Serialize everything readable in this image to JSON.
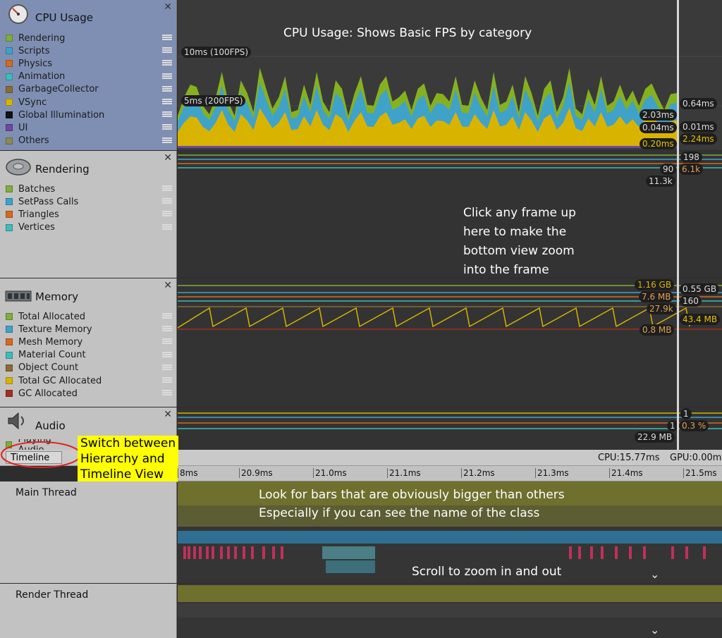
{
  "cpu": {
    "title": "CPU Usage",
    "close": "✕",
    "legend": [
      {
        "label": "Rendering",
        "color": "#7fae3a"
      },
      {
        "label": "Scripts",
        "color": "#3fa2c9"
      },
      {
        "label": "Physics",
        "color": "#d46a1f"
      },
      {
        "label": "Animation",
        "color": "#3fbbbb"
      },
      {
        "label": "GarbageCollector",
        "color": "#8a6b36"
      },
      {
        "label": "VSync",
        "color": "#d8b400"
      },
      {
        "label": "Global Illumination",
        "color": "#111111"
      },
      {
        "label": "UI",
        "color": "#6f48a0"
      },
      {
        "label": "Others",
        "color": "#8a8a55"
      }
    ],
    "grid_10ms": "10ms (100FPS)",
    "grid_5ms": "5ms (200FPS)",
    "values_left": [
      "2.03ms",
      "0.04ms",
      "0.20ms"
    ],
    "values_right": [
      "0.64ms",
      "0.01ms",
      "2.24ms"
    ],
    "annotation": "CPU Usage: Shows Basic FPS by category",
    "series_levels": [
      0.45,
      0.6,
      0.75,
      0.85,
      0.5,
      0.4,
      0.7,
      0.9,
      0.55,
      0.45,
      0.8,
      0.65,
      0.5,
      0.95,
      0.7,
      0.55,
      0.6,
      0.85,
      0.5,
      0.45,
      0.75,
      0.6,
      0.9,
      0.55,
      0.5,
      0.8,
      0.7,
      0.45,
      0.65,
      0.85,
      0.6,
      0.5,
      0.75,
      1.0,
      0.55,
      0.6,
      0.8,
      0.45,
      0.7,
      0.9,
      0.5,
      0.65,
      0.75,
      0.55,
      0.85,
      0.6,
      0.5,
      0.8,
      0.7,
      0.45,
      0.9,
      0.6,
      0.55,
      0.75,
      0.5,
      0.85,
      0.65,
      0.45,
      0.7,
      0.8,
      0.5,
      0.6,
      0.95,
      0.55,
      0.4,
      0.7,
      0.6,
      0.85,
      0.5,
      0.65,
      0.75,
      0.55,
      0.8,
      0.5,
      0.7,
      0.9,
      0.6,
      0.45,
      0.75,
      0.65
    ]
  },
  "rendering": {
    "title": "Rendering",
    "close": "✕",
    "legend": [
      {
        "label": "Batches",
        "color": "#7fae3a"
      },
      {
        "label": "SetPass Calls",
        "color": "#3fa2c9"
      },
      {
        "label": "Triangles",
        "color": "#d46a1f"
      },
      {
        "label": "Vertices",
        "color": "#3fbbbb"
      }
    ],
    "values": [
      "198",
      "90",
      "6.1k",
      "11.3k"
    ],
    "annotation": [
      "Click any frame up",
      "here to make the",
      "bottom view zoom",
      "into the frame"
    ]
  },
  "memory": {
    "title": "Memory",
    "close": "✕",
    "legend": [
      {
        "label": "Total Allocated",
        "color": "#7fae3a"
      },
      {
        "label": "Texture Memory",
        "color": "#3fa2c9"
      },
      {
        "label": "Mesh Memory",
        "color": "#d46a1f"
      },
      {
        "label": "Material Count",
        "color": "#3fbbbb"
      },
      {
        "label": "Object Count",
        "color": "#8a6b36"
      },
      {
        "label": "Total GC Allocated",
        "color": "#d8b400"
      },
      {
        "label": "GC Allocated",
        "color": "#a0301f"
      }
    ],
    "values": [
      "1.16 GB",
      "7.6 MB",
      "27.9k",
      "0.8 MB",
      "0.55 GB",
      "160",
      "43.4 MB"
    ]
  },
  "audio": {
    "title": "Audio",
    "close": "✕",
    "legend_partial": "Playing Audio",
    "values": [
      "1",
      "1",
      "0.3 %",
      "22.9 MB"
    ]
  },
  "timeline_header": {
    "view_select": "Timeline",
    "cpu": "CPU:15.77ms",
    "gpu": "GPU:0.00m",
    "callout": [
      "Switch between",
      "Hierarchy and",
      "Timeline View"
    ]
  },
  "ruler": [
    "8ms",
    "20.9ms",
    "21.0ms",
    "21.1ms",
    "21.2ms",
    "21.3ms",
    "21.4ms",
    "21.5ms"
  ],
  "threads": {
    "main": "Main Thread",
    "render": "Render Thread",
    "annotation": [
      "Look for bars that are obviously bigger than others",
      "Especially if you can see the name of the class"
    ],
    "scroll_note": "Scroll to zoom in and out",
    "chevron": "⌄"
  }
}
